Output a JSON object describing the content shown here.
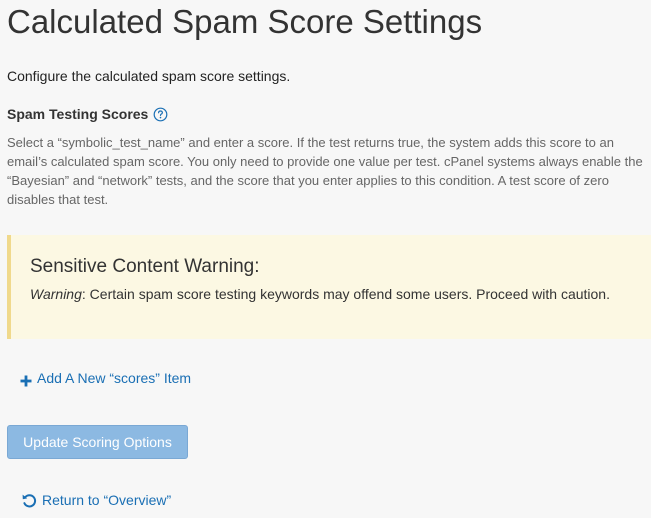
{
  "page": {
    "title": "Calculated Spam Score Settings",
    "intro": "Configure the calculated spam score settings."
  },
  "section": {
    "heading": "Spam Testing Scores",
    "help_icon": "question-circle-icon",
    "description": "Select a “symbolic_test_name” and enter a score. If the test returns true, the system adds this score to an email’s calculated spam score. You only need to provide one value per test. cPanel systems always enable the “Bayesian” and “network” tests, and the score that you enter applies to this condition. A test score of zero disables that test."
  },
  "warning": {
    "title": "Sensitive Content Warning:",
    "label": "Warning",
    "text": ": Certain spam score testing keywords may offend some users. Proceed with caution."
  },
  "actions": {
    "add_item_label": "Add A New “scores” Item",
    "add_item_icon": "plus-icon",
    "update_button_label": "Update Scoring Options",
    "return_label": "Return to “Overview”",
    "return_icon": "undo-icon"
  },
  "colors": {
    "link": "#1a6fb4",
    "warning_background": "#fcf8e3",
    "warning_border": "#f0d98c",
    "button_background": "#8cb9e2"
  }
}
